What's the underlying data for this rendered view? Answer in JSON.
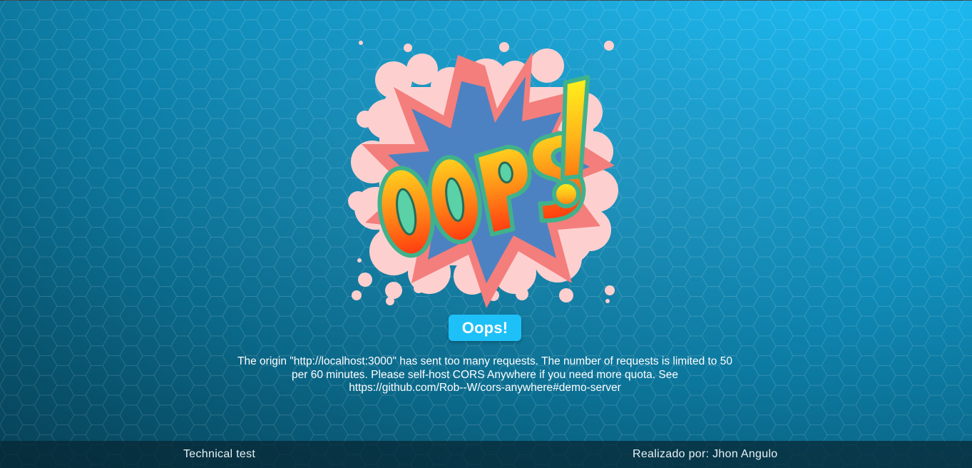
{
  "error": {
    "badge_label": "Oops!",
    "message": "The origin \"http://localhost:3000\" has sent too many requests. The number of requests is limited to 50 per 60 minutes. Please self-host CORS Anywhere if you need more quota. See https://github.com/Rob--W/cors-anywhere#demo-server",
    "illustration_text": "OOPS!",
    "illustration_icon": "comic-explosion-oops-illustration"
  },
  "footer": {
    "left_text": "Technical test",
    "right_text": "Realizado por: Jhon Angulo"
  },
  "colors": {
    "background_light": "#1fc2fb",
    "background_dark": "#084e68",
    "badge": "#1ec0f8",
    "footer_bg": "#072632",
    "text": "#ffffff"
  }
}
